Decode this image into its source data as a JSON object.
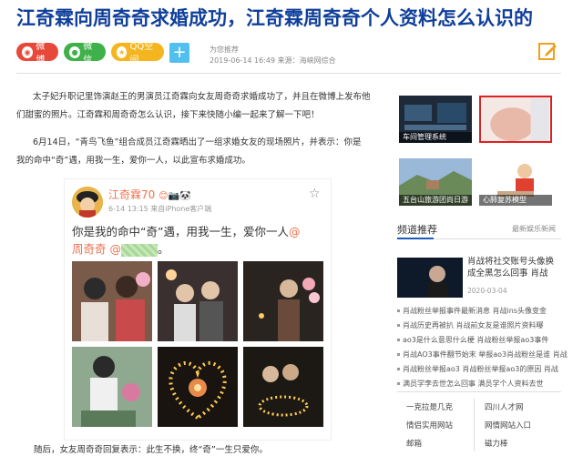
{
  "article": {
    "title": "江奇霖向周奇奇求婚成功，江奇霖周奇奇个人资料怎么认识的",
    "source_label": "为您推荐",
    "date_source": "2019-06-14 16:49   来源：海峡网综合",
    "paragraphs": [
      "太子妃升职记里饰演赵王的男演员江奇霖向女友周奇奇求婚成功了，并且在微博上发布他",
      "们甜蜜的照片。江奇霖和周奇奇怎么认识，接下来快随小编一起来了解一下吧！",
      "6月14日，“青鸟飞鱼”组合成员江奇霖晒出了一组求婚女友的现场照片，并表示：你是",
      "我的命中“奇”遇，用我一生，爱你一人，以此宣布求婚成功。"
    ],
    "last_paragraph": "随后，女友周奇奇回复表示：此生不换，终“奇”一生只爱你。"
  },
  "share": {
    "weibo": "微博",
    "wechat": "微信",
    "qzone": "QQ空间",
    "more": "+"
  },
  "weibo_post": {
    "username": "江奇霖70",
    "meta": "6-14 13:15  来自iPhone客户端",
    "text_line1_a": "你是我的命中“奇”遇，用我一生，爱你一人",
    "text_at1": "@",
    "text_line2_at": "周奇奇 @",
    "text_line2_end": "。"
  },
  "sidebar": {
    "thumbs": [
      {
        "caption": "车间管理系统"
      },
      {
        "caption": ""
      },
      {
        "caption": "五台山旅游团尚日游"
      },
      {
        "caption": "心肺复苏模型"
      }
    ],
    "section_title": "频道推荐",
    "section_right": "最新娱乐新闻",
    "featured": {
      "title": "肖战将社交账号头像换成全黑怎么回事 肖战",
      "date": "2020-03-04"
    },
    "list": [
      "肖战粉丝举报事件最新消息  肖战ins头像变金",
      "肖战历史再被扒  肖战前女友是谁照片资料曝",
      "ao3是什么意思什么梗  肖战粉丝举报ao3事件",
      "肖战AO3事件翻节始末  举报ao3肖战粉丝是谁  肖战",
      "肖战粉丝举报ao3 肖战粉丝举报ao3的原因  肖战",
      "满员学李去世怎么回事  满员学个人资料去世"
    ],
    "links": [
      [
        "一克拉是几克",
        "四川人才网"
      ],
      [
        "情侣实用网站",
        "网情网站入口"
      ],
      [
        "邮箱",
        "磁力棒"
      ]
    ]
  }
}
